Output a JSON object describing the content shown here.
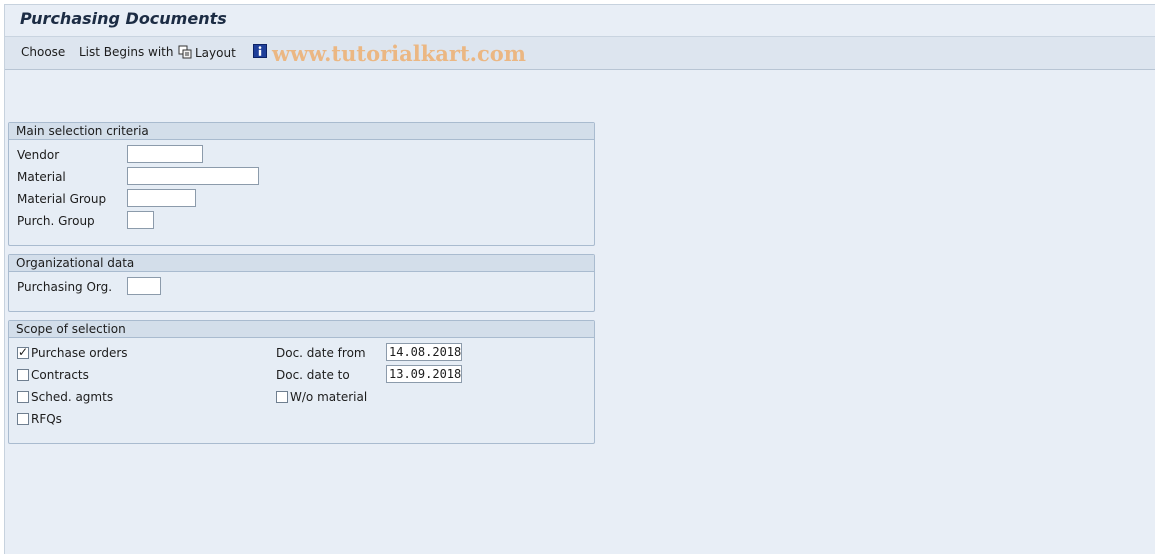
{
  "title": "Purchasing Documents",
  "toolbar": {
    "choose": "Choose",
    "list_begins_with": "List Begins with",
    "layout": "Layout",
    "watermark": "www.tutorialkart.com"
  },
  "icons": {
    "layout": "layout-icon",
    "info": "info-icon"
  },
  "colors": {
    "background": "#e8eef6",
    "group_header": "#d3deea",
    "watermark": "#f0a860",
    "info_icon": "#1f3f9a"
  },
  "main_selection": {
    "header": "Main selection criteria",
    "vendor_label": "Vendor",
    "vendor_value": "",
    "material_label": "Material",
    "material_value": "",
    "material_group_label": "Material Group",
    "material_group_value": "",
    "purch_group_label": "Purch. Group",
    "purch_group_value": ""
  },
  "org_data": {
    "header": "Organizational data",
    "purch_org_label": "Purchasing Org.",
    "purch_org_value": ""
  },
  "scope": {
    "header": "Scope of selection",
    "purchase_orders_label": "Purchase orders",
    "purchase_orders_checked": true,
    "contracts_label": "Contracts",
    "contracts_checked": false,
    "sched_agmts_label": "Sched. agmts",
    "sched_agmts_checked": false,
    "rfqs_label": "RFQs",
    "rfqs_checked": false,
    "doc_date_from_label": "Doc. date from",
    "doc_date_from_value": "14.08.2018",
    "doc_date_to_label": "Doc. date to",
    "doc_date_to_value": "13.09.2018",
    "wo_material_label": "W/o material",
    "wo_material_checked": false
  }
}
